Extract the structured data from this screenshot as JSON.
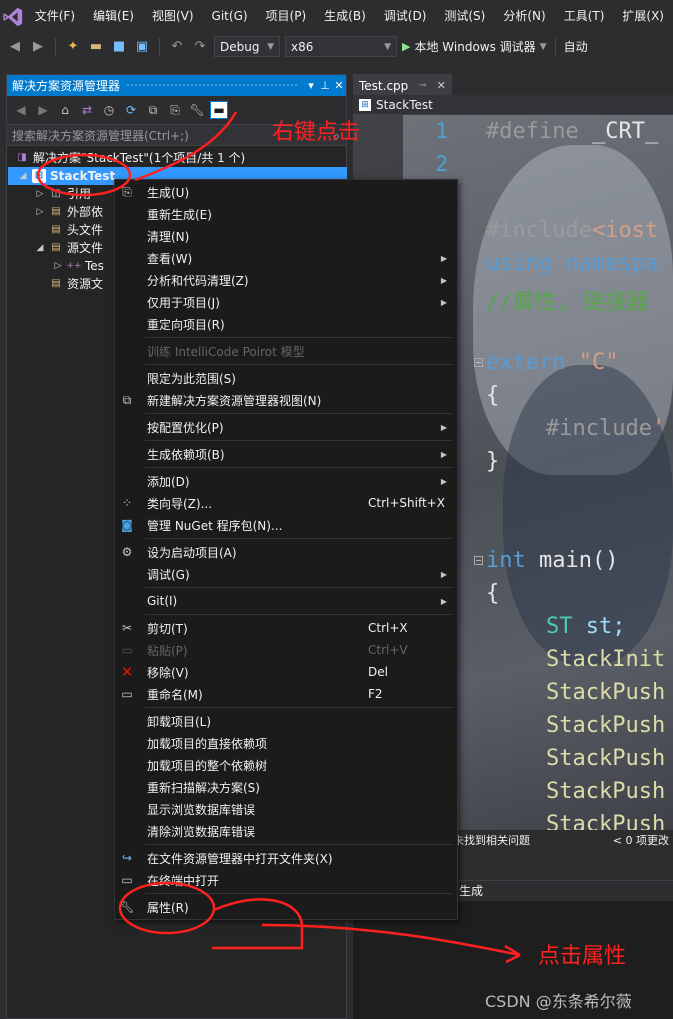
{
  "menubar": {
    "items": [
      "文件(F)",
      "编辑(E)",
      "视图(V)",
      "Git(G)",
      "项目(P)",
      "生成(B)",
      "调试(D)",
      "测试(S)",
      "分析(N)",
      "工具(T)",
      "扩展(X)"
    ]
  },
  "toolbar": {
    "config": "Debug",
    "platform": "x86",
    "run_label": "本地 Windows 调试器",
    "auto_label": "自动"
  },
  "solution_explorer": {
    "title": "解决方案资源管理器",
    "search_placeholder": "搜索解决方案资源管理器(Ctrl+;)",
    "tree": {
      "solution": "解决方案\"StackTest\"(1个项目/共 1 个)",
      "project": "StackTest",
      "references": "引用",
      "external": "外部依",
      "headers": "头文件",
      "sources": "源文件",
      "test_file": "Tes",
      "resources": "资源文"
    }
  },
  "editor": {
    "tab_label": "Test.cpp",
    "nav_label": "StackTest",
    "line_numbers": [
      "1",
      "2"
    ],
    "lines": {
      "l1_kw": "#define",
      "l1_rest": " _CRT_",
      "l3_kw": "#include",
      "l3_rest": "<iost",
      "l4_kw": "using",
      "l4_rest": " namespa",
      "l5": "//属性, 链接器",
      "l6_kw": "extern",
      "l6_str": " \"C\"",
      "l7": "{",
      "l8_kw": "#include",
      "l8_rest": "'",
      "l9": "}",
      "l10_kw": "int",
      "l10_rest": " main()",
      "l11": "{",
      "l12_kw": "ST",
      "l12_rest": " st;",
      "l13": "StackInit",
      "l14": "StackPush",
      "l15": "StackPush",
      "l16": "StackPush",
      "l17": "StackPush",
      "l18": "StackPush"
    },
    "status_left": "未找到相关问题",
    "status_right": "< 0  项更改",
    "output_title": "生成"
  },
  "context_menu": {
    "items": [
      {
        "label": "生成(U)",
        "shortcut": "",
        "icon": "build-icon"
      },
      {
        "label": "重新生成(E)",
        "shortcut": ""
      },
      {
        "label": "清理(N)",
        "shortcut": ""
      },
      {
        "label": "查看(W)",
        "shortcut": ""
      },
      {
        "label": "分析和代码清理(Z)",
        "shortcut": ""
      },
      {
        "label": "仅用于项目(J)",
        "shortcut": ""
      },
      {
        "label": "重定向项目(R)",
        "shortcut": ""
      },
      {
        "label": "训练 IntelliCode Poirot 模型",
        "shortcut": ""
      },
      {
        "label": "限定为此范围(S)",
        "shortcut": ""
      },
      {
        "label": "新建解决方案资源管理器视图(N)",
        "shortcut": ""
      },
      {
        "label": "按配置优化(P)",
        "shortcut": ""
      },
      {
        "label": "生成依赖项(B)",
        "shortcut": ""
      },
      {
        "label": "添加(D)",
        "shortcut": ""
      },
      {
        "label": "类向导(Z)...",
        "shortcut": "Ctrl+Shift+X"
      },
      {
        "label": "管理 NuGet 程序包(N)...",
        "shortcut": ""
      },
      {
        "label": "设为启动项目(A)",
        "shortcut": ""
      },
      {
        "label": "调试(G)",
        "shortcut": ""
      },
      {
        "label": "Git(I)",
        "shortcut": ""
      },
      {
        "label": "剪切(T)",
        "shortcut": "Ctrl+X"
      },
      {
        "label": "粘贴(P)",
        "shortcut": "Ctrl+V"
      },
      {
        "label": "移除(V)",
        "shortcut": "Del"
      },
      {
        "label": "重命名(M)",
        "shortcut": "F2"
      },
      {
        "label": "卸载项目(L)",
        "shortcut": ""
      },
      {
        "label": "加载项目的直接依赖项",
        "shortcut": ""
      },
      {
        "label": "加载项目的整个依赖树",
        "shortcut": ""
      },
      {
        "label": "重新扫描解决方案(S)",
        "shortcut": ""
      },
      {
        "label": "显示浏览数据库错误",
        "shortcut": ""
      },
      {
        "label": "清除浏览数据库错误",
        "shortcut": ""
      },
      {
        "label": "在文件资源管理器中打开文件夹(X)",
        "shortcut": ""
      },
      {
        "label": "在终端中打开",
        "shortcut": ""
      },
      {
        "label": "属性(R)",
        "shortcut": ""
      }
    ]
  },
  "annotations": {
    "right_click": "右键点击",
    "click_properties": "点击属性",
    "color": "#ff2020"
  },
  "watermark": "CSDN @东条希尔薇",
  "colors": {
    "accent": "#007acc",
    "selection": "#3399ff",
    "menu_bg": "#1b1b1c"
  }
}
